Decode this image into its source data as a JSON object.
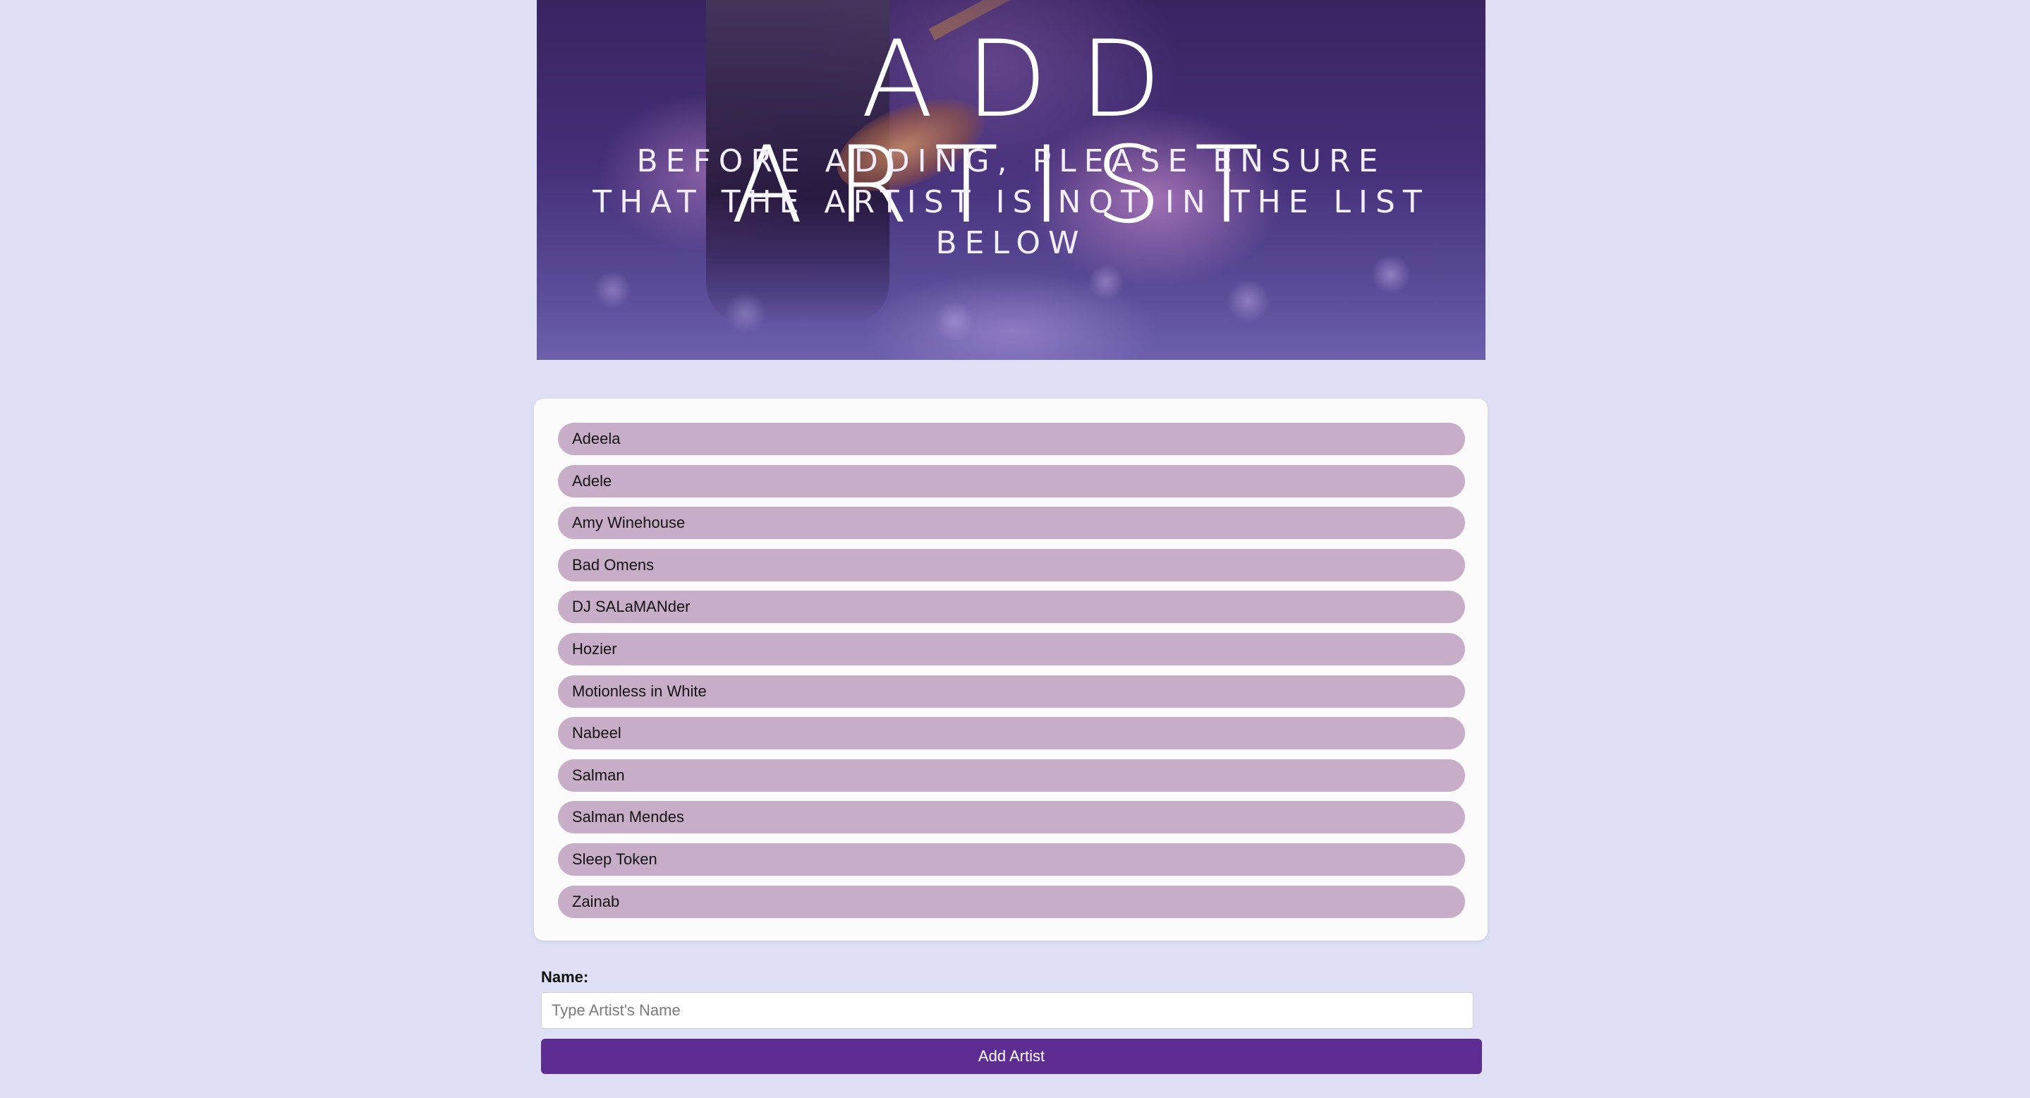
{
  "hero": {
    "title": "ADD ARTIST",
    "subtitle": "Before adding, please ensure that the artist is not in the list below"
  },
  "artists": [
    "Adeela",
    "Adele",
    "Amy Winehouse",
    "Bad Omens",
    "DJ SALaMANder",
    "Hozier",
    "Motionless in White",
    "Nabeel",
    "Salman",
    "Salman Mendes",
    "Sleep Token",
    "Zainab"
  ],
  "form": {
    "name_label": "Name:",
    "name_placeholder": "Type Artist's Name",
    "name_value": "",
    "submit_label": "Add Artist"
  },
  "colors": {
    "page_background": "#dedff5",
    "list_item": "#c8adc8",
    "button": "#5e2d91"
  }
}
